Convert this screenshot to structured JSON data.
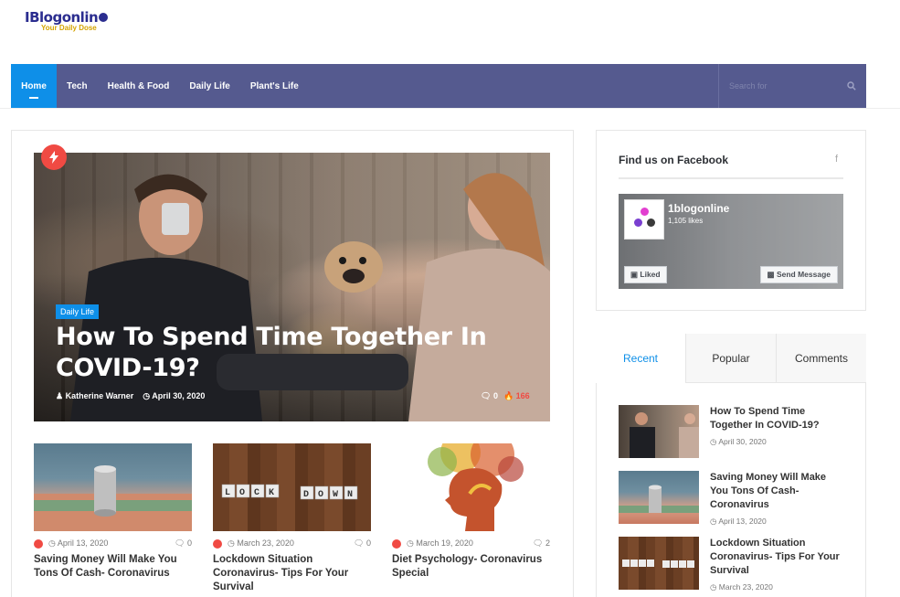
{
  "logo": {
    "main": "IBlogonlin",
    "tagline": "Your Daily Dose"
  },
  "nav": {
    "items": [
      "Home",
      "Tech",
      "Health & Food",
      "Daily Life",
      "Plant's Life"
    ],
    "search_placeholder": "Search for"
  },
  "hero": {
    "category": "Daily Life",
    "title": "How To Spend Time Together In COVID-19?",
    "author": "Katherine Warner",
    "date": "April 30, 2020",
    "comments": "0",
    "views": "166"
  },
  "cards": [
    {
      "date": "April 13, 2020",
      "comments": "0",
      "title": "Saving Money Will Make You Tons Of Cash- Coronavirus"
    },
    {
      "date": "March 23, 2020",
      "comments": "0",
      "title": "Lockdown Situation Coronavirus- Tips For Your Survival"
    },
    {
      "date": "March 19, 2020",
      "comments": "2",
      "title": "Diet Psychology- Coronavirus Special"
    }
  ],
  "facebook": {
    "title": "Find us on Facebook",
    "page_name": "1blogonline",
    "likes": "1,105 likes",
    "liked_label": "Liked",
    "message_label": "Send Message"
  },
  "tabs": [
    "Recent",
    "Popular",
    "Comments"
  ],
  "recent": [
    {
      "title": "How To Spend Time Together In COVID-19?",
      "date": "April 30, 2020"
    },
    {
      "title": "Saving Money Will Make You Tons Of Cash- Coronavirus",
      "date": "April 13, 2020"
    },
    {
      "title": "Lockdown Situation Coronavirus- Tips For Your Survival",
      "date": "March 23, 2020"
    }
  ],
  "colors": {
    "nav": "#555a8f",
    "accent": "#0e8fe8",
    "hot": "#f04a43"
  }
}
